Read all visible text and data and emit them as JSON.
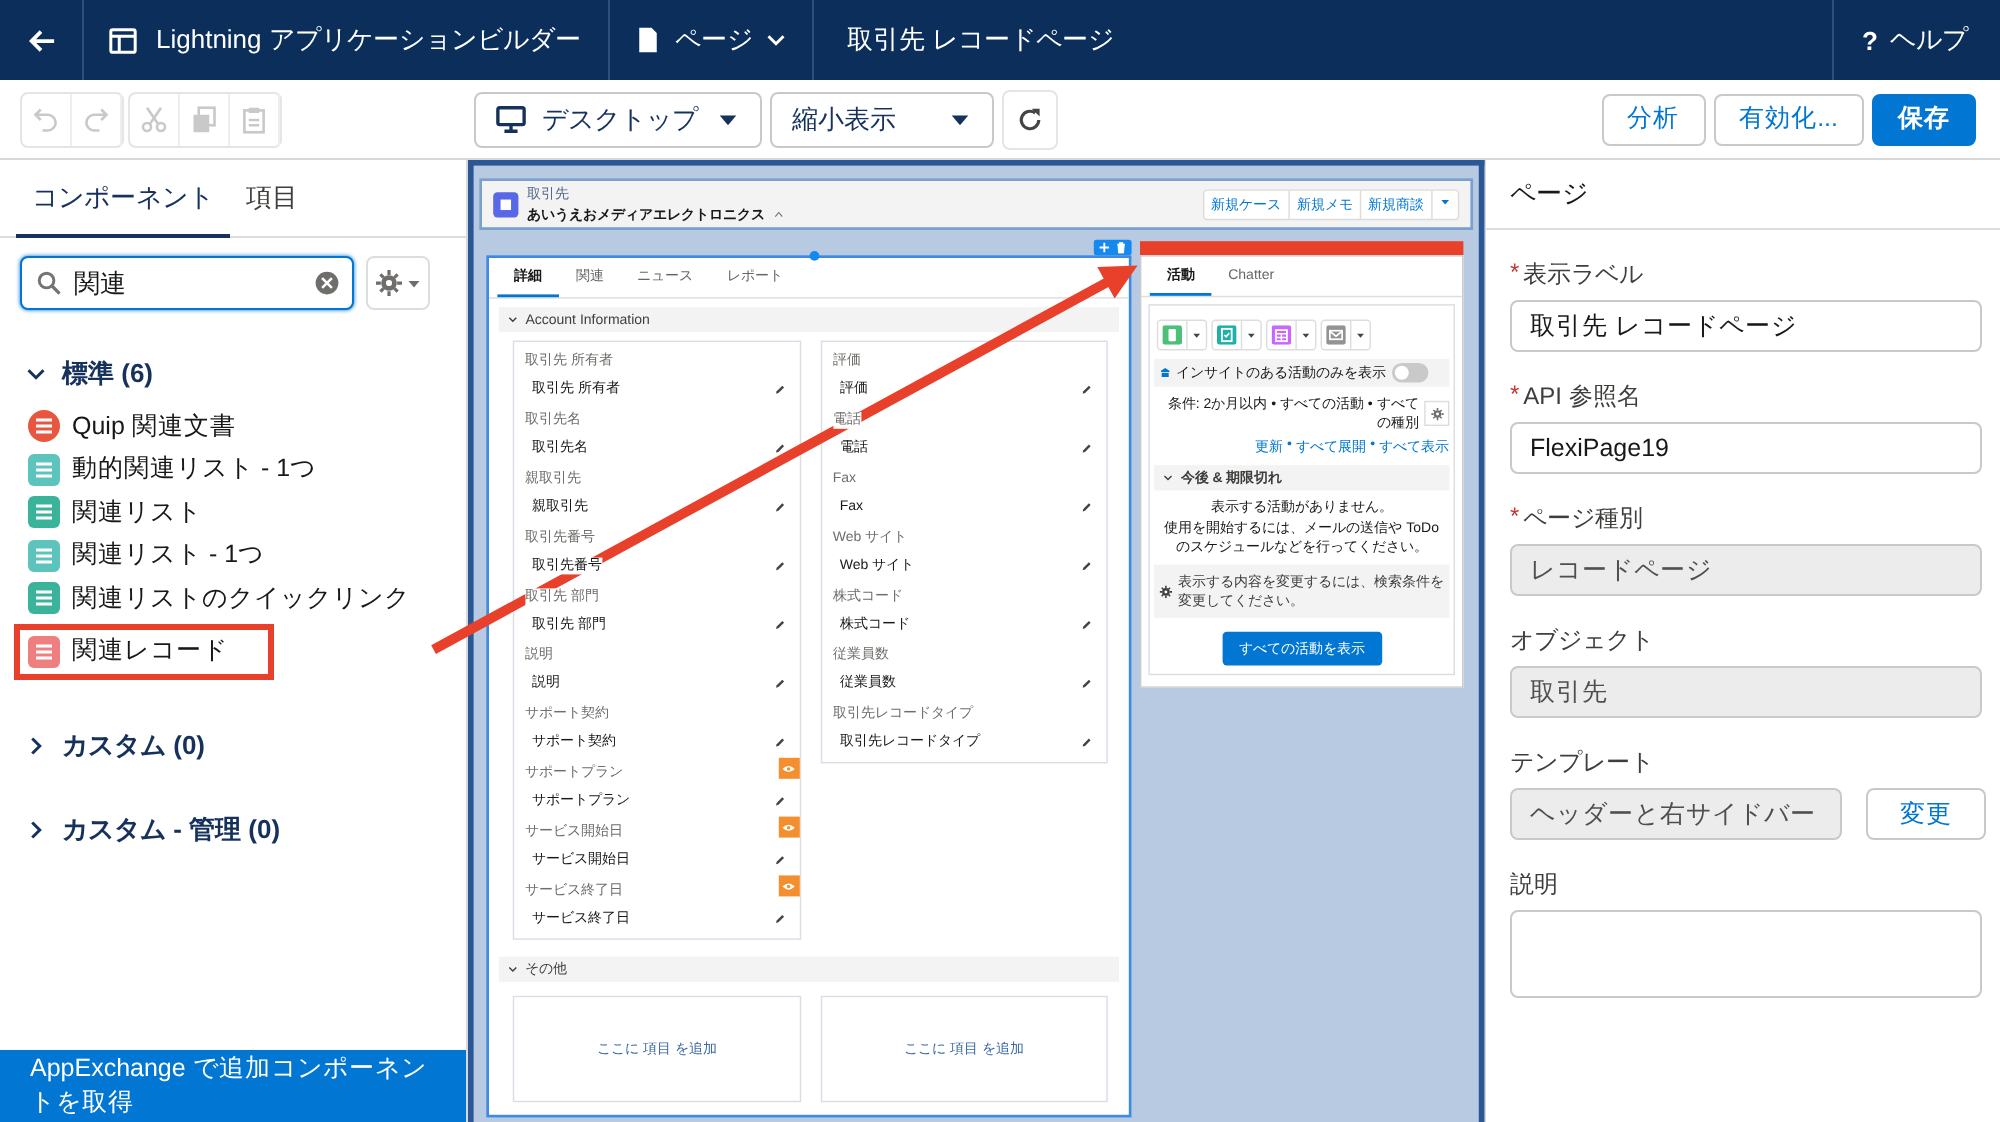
{
  "top_bar": {
    "app_title": "Lightning アプリケーションビルダー",
    "page_menu": "ページ",
    "page_title": "取引先 レコードページ",
    "help_mark": "?",
    "help": "ヘルプ"
  },
  "toolbar": {
    "edit_buttons": [
      {
        "kind": "undo",
        "disabled": true
      },
      {
        "kind": "redo",
        "disabled": true
      },
      {
        "kind": "cut",
        "disabled": true
      },
      {
        "kind": "copy",
        "disabled": true
      },
      {
        "kind": "paste",
        "disabled": true
      }
    ],
    "device": "デスクトップ",
    "zoom": "縮小表示",
    "actions": [
      {
        "label": "分析",
        "kind": "neutral"
      },
      {
        "label": "有効化...",
        "kind": "neutral"
      },
      {
        "label": "保存",
        "kind": "brand"
      }
    ]
  },
  "components_panel": {
    "tabs": [
      {
        "label": "コンポーネント",
        "selected": true
      },
      {
        "label": "項目",
        "selected": false
      }
    ],
    "search": {
      "value": "関連"
    },
    "groups": [
      {
        "title": "標準 (6)",
        "expanded": true,
        "items": [
          {
            "label": "Quip 関連文書",
            "kind": "circle",
            "color": "#e8563f",
            "highlighted": false
          },
          {
            "label": "動的関連リスト - 1つ",
            "kind": "square",
            "color": "#5cc4bd",
            "highlighted": false
          },
          {
            "label": "関連リスト",
            "kind": "square",
            "color": "#3bb39a",
            "highlighted": false
          },
          {
            "label": "関連リスト - 1つ",
            "kind": "square",
            "color": "#5cc4bd",
            "highlighted": false
          },
          {
            "label": "関連リストのクイックリンク",
            "kind": "square",
            "color": "#3bb39a",
            "highlighted": false
          },
          {
            "label": "関連レコード",
            "kind": "square",
            "color": "#ef7f7f",
            "highlighted": true
          }
        ]
      },
      {
        "title": "カスタム (0)",
        "expanded": false
      },
      {
        "title": "カスタム - 管理 (0)",
        "expanded": false
      }
    ],
    "footer": "AppExchange で追加コンポーネントを取得"
  },
  "canvas": {
    "header": {
      "object": "取引先",
      "name": "あいうえおメディアエレクトロニクス",
      "actions": [
        "新規ケース",
        "新規メモ",
        "新規商談"
      ]
    },
    "tabs": [
      {
        "label": "詳細",
        "selected": true
      },
      {
        "label": "関連",
        "selected": false
      },
      {
        "label": "ニュース",
        "selected": false
      },
      {
        "label": "レポート",
        "selected": false
      }
    ],
    "sections": [
      {
        "title": "Account Information",
        "expanded": true,
        "columns": [
          [
            {
              "label": "取引先 所有者",
              "value": "取引先 所有者",
              "visibility_rule": false
            },
            {
              "label": "取引先名",
              "value": "取引先名",
              "visibility_rule": false
            },
            {
              "label": "親取引先",
              "value": "親取引先",
              "visibility_rule": false
            },
            {
              "label": "取引先番号",
              "value": "取引先番号",
              "visibility_rule": false
            },
            {
              "label": "取引先 部門",
              "value": "取引先 部門",
              "visibility_rule": false
            },
            {
              "label": "説明",
              "value": "説明",
              "visibility_rule": false
            },
            {
              "label": "サポート契約",
              "value": "サポート契約",
              "visibility_rule": false
            },
            {
              "label": "サポートプラン",
              "value": "サポートプラン",
              "visibility_rule": true
            },
            {
              "label": "サービス開始日",
              "value": "サービス開始日",
              "visibility_rule": true
            },
            {
              "label": "サービス終了日",
              "value": "サービス終了日",
              "visibility_rule": true
            }
          ],
          [
            {
              "label": "評価",
              "value": "評価",
              "visibility_rule": false
            },
            {
              "label": "電話",
              "value": "電話",
              "visibility_rule": false
            },
            {
              "label": "Fax",
              "value": "Fax",
              "visibility_rule": false
            },
            {
              "label": "Web サイト",
              "value": "Web サイト",
              "visibility_rule": false
            },
            {
              "label": "株式コード",
              "value": "株式コード",
              "visibility_rule": false
            },
            {
              "label": "従業員数",
              "value": "従業員数",
              "visibility_rule": false
            },
            {
              "label": "取引先レコードタイプ",
              "value": "取引先レコードタイプ",
              "visibility_rule": false
            }
          ]
        ]
      },
      {
        "title": "その他",
        "expanded": true,
        "placeholders": [
          "ここに 項目 を追加",
          "ここに 項目 を追加"
        ]
      }
    ],
    "activity": {
      "highlighted": true,
      "tabs": [
        {
          "label": "活動",
          "selected": true
        },
        {
          "label": "Chatter",
          "selected": false
        }
      ],
      "actions": [
        {
          "kind": "call"
        },
        {
          "kind": "task"
        },
        {
          "kind": "event"
        },
        {
          "kind": "email"
        }
      ],
      "insight_toggle": {
        "label": "インサイトのある活動のみを表示",
        "on": false
      },
      "filter": "条件: 2か月以内 • すべての活動 • すべての種別",
      "links": [
        "更新",
        "すべて展開",
        "すべて表示"
      ],
      "link_separator": "•",
      "section": "今後 & 期限切れ",
      "empty_title": "表示する活動がありません。",
      "empty_text": "使用を開始するには、メールの送信や ToDo のスケジュールなどを行ってください。",
      "hint": "表示する内容を変更するには、検索条件を変更してください。",
      "button": "すべての活動を表示"
    }
  },
  "properties_panel": {
    "title": "ページ",
    "required_mark": "*",
    "fields": [
      {
        "label": "表示ラベル",
        "required": true,
        "kind": "text",
        "value": "取引先 レコードページ",
        "disabled": false
      },
      {
        "label": "API 参照名",
        "required": true,
        "kind": "text",
        "value": "FlexiPage19",
        "disabled": false
      },
      {
        "label": "ページ種別",
        "required": true,
        "kind": "text",
        "value": "レコードページ",
        "disabled": true
      },
      {
        "label": "オブジェクト",
        "required": false,
        "kind": "text",
        "value": "取引先",
        "disabled": true
      },
      {
        "label": "テンプレート",
        "required": false,
        "kind": "text",
        "value": "ヘッダーと右サイドバー",
        "disabled": true,
        "button": "変更"
      },
      {
        "label": "説明",
        "required": false,
        "kind": "textarea",
        "disabled": false
      }
    ]
  }
}
